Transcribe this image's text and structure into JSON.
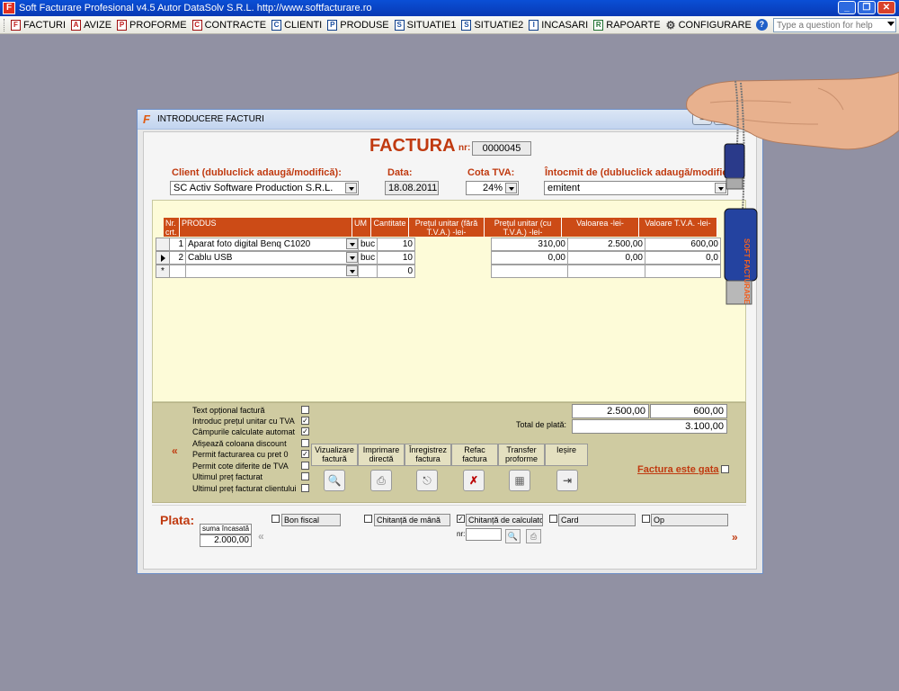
{
  "app": {
    "title": "Soft Facturare Profesional v4.5 Autor DataSolv S.R.L. http://www.softfacturare.ro",
    "help_placeholder": "Type a question for help"
  },
  "menu": [
    {
      "label": "FACTURI",
      "icon": "F"
    },
    {
      "label": "AVIZE",
      "icon": "A"
    },
    {
      "label": "PROFORME",
      "icon": "P"
    },
    {
      "label": "CONTRACTE",
      "icon": "C"
    },
    {
      "label": "CLIENTI",
      "icon": "C"
    },
    {
      "label": "PRODUSE",
      "icon": "P"
    },
    {
      "label": "SITUATIE1",
      "icon": "S"
    },
    {
      "label": "SITUATIE2",
      "icon": "S"
    },
    {
      "label": "INCASARI",
      "icon": "I"
    },
    {
      "label": "RAPOARTE",
      "icon": "R"
    },
    {
      "label": "CONFIGURARE",
      "icon": "gear-icon"
    }
  ],
  "dialog": {
    "title": "INTRODUCERE FACTURI"
  },
  "header": {
    "doc_title": "FACTURA",
    "nr_label": "nr:",
    "nr_value": "0000045",
    "client_label": "Client (dubluclick adaugă/modifică):",
    "client_value": "SC Activ Software Production S.R.L.",
    "date_label": "Data:",
    "date_value": "18.08.2011",
    "tva_label": "Cota TVA:",
    "tva_value": "24%",
    "issued_label": "Întocmit de (dubluclick adaugă/modifică):",
    "issued_value": "emitent"
  },
  "grid": {
    "columns": [
      "Nr. crt.",
      "PRODUS",
      "UM",
      "Cantitate",
      "Prețul unitar (fără T.V.A.) -lei-",
      "Prețul unitar (cu T.V.A.) -lei-",
      "Valoarea -lei-",
      "Valoare T.V.A. -lei-"
    ],
    "rows": [
      {
        "nr": "1",
        "produs": "Aparat foto digital Benq C1020",
        "um": "buc",
        "cantitate": "10",
        "pret_fara": "",
        "pret_cu": "310,00",
        "valoare": "2.500,00",
        "valoare_tva": "600,00"
      },
      {
        "nr": "2",
        "produs": "Cablu USB",
        "um": "buc",
        "cantitate": "10",
        "pret_fara": "",
        "pret_cu": "0,00",
        "valoare": "0,00",
        "valoare_tva": "0,0"
      },
      {
        "nr": "",
        "produs": "",
        "um": "",
        "cantitate": "0",
        "pret_fara": "",
        "pret_cu": "",
        "valoare": "",
        "valoare_tva": ""
      }
    ],
    "new_row_marker": "*"
  },
  "options": [
    {
      "label": "Text opțional factură",
      "checked": false
    },
    {
      "label": "Introduc prețul unitar cu TVA",
      "checked": true
    },
    {
      "label": "Câmpurile calculate automat",
      "checked": true
    },
    {
      "label": "Afișează coloana discount",
      "checked": false
    },
    {
      "label": "Permit facturarea cu pret 0",
      "checked": true
    },
    {
      "label": "Permit cote diferite de TVA",
      "checked": false
    },
    {
      "label": "Ultimul preț facturat",
      "checked": false
    },
    {
      "label": "Ultimul preț facturat clientului",
      "checked": false
    }
  ],
  "totals": {
    "valoare": "2.500,00",
    "tva": "600,00",
    "total_label": "Total de plată:",
    "total": "3.100,00"
  },
  "actions": [
    {
      "label": "Vizualizare factură",
      "icon": "preview-icon"
    },
    {
      "label": "Imprimare directă",
      "icon": "printer-icon"
    },
    {
      "label": "Înregistrez factura",
      "icon": "register-icon"
    },
    {
      "label": "Refac factura",
      "icon": "redo-icon"
    },
    {
      "label": "Transfer proforme",
      "icon": "transfer-icon"
    },
    {
      "label": "Ieșire",
      "icon": "exit-icon"
    }
  ],
  "nav": {
    "left": "«",
    "prev": "«",
    "next": "»"
  },
  "ready": {
    "label": "Factura este gata",
    "checked": false
  },
  "payment": {
    "label": "Plata:",
    "suma_label": "suma încasată",
    "suma_value": "2.000,00",
    "nr_label": "nr:",
    "methods": [
      {
        "label": "Bon fiscal",
        "checked": false
      },
      {
        "label": "Chitanță de mână",
        "checked": false
      },
      {
        "label": "Chitanță de calculator",
        "checked": true
      },
      {
        "label": "Card",
        "checked": false
      },
      {
        "label": "Op",
        "checked": false
      }
    ]
  },
  "colors": {
    "accent": "#c03a10",
    "grid_header": "#cc4b16",
    "grid_bg": "#fdfbd8",
    "lower_bg": "#cfcba1",
    "desktop": "#9191a3",
    "titlebar": "#0a4fd6"
  },
  "decoration": {
    "usb_stick_text": "SOFT FACTURARE"
  }
}
